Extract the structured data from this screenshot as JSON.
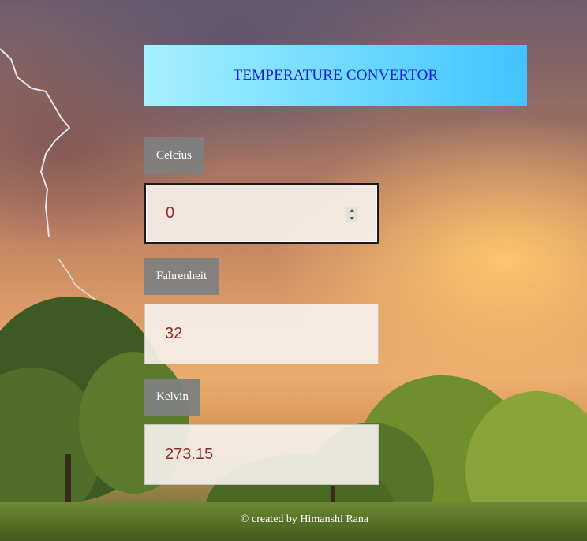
{
  "header": {
    "title": "TEMPERATURE CONVERTOR"
  },
  "fields": [
    {
      "label": "Celcius",
      "value": "0"
    },
    {
      "label": "Fahrenheit",
      "value": "32"
    },
    {
      "label": "Kelvin",
      "value": "273.15"
    }
  ],
  "footer": {
    "text": "© created by Himanshi Rana"
  },
  "colors": {
    "title_text": "#1a1ad9",
    "title_gradient_start": "#a6f0ff",
    "title_gradient_end": "#40c3ff",
    "label_bg": "#808080",
    "value_text": "#8a2e2a"
  },
  "icons": {
    "spinner": "number-spinner-icon"
  }
}
